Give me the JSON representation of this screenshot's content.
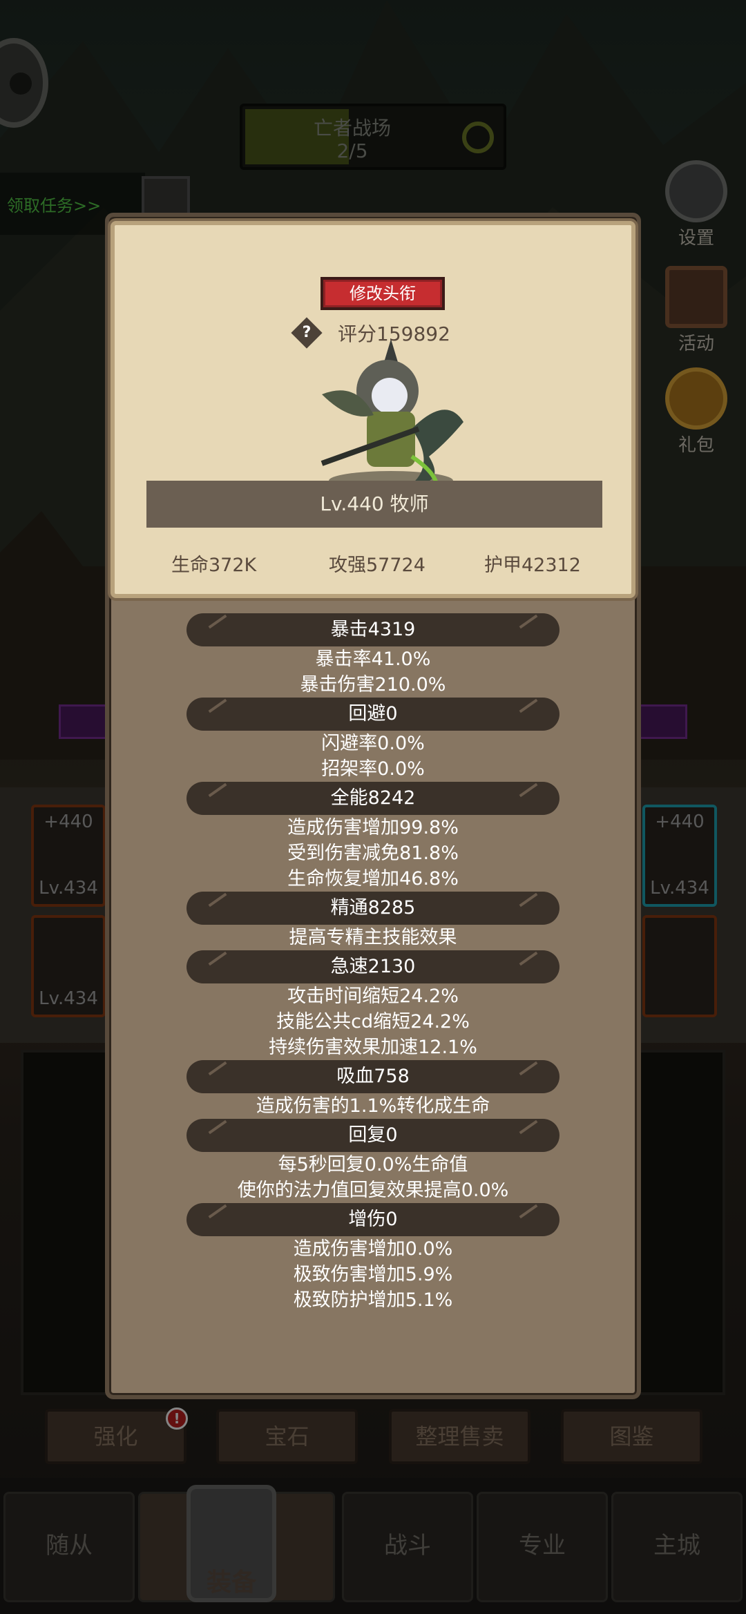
{
  "hud": {
    "arena_title": "亡者战场",
    "arena_count": "2/5",
    "task_link": "领取任务>>",
    "side_buttons": [
      {
        "label": "设置",
        "icon": "gear-icon"
      },
      {
        "label": "活动",
        "icon": "scroll-icon"
      },
      {
        "label": "礼包",
        "icon": "gift-icon"
      }
    ]
  },
  "background_equipment": [
    {
      "plus": "+440",
      "level": "Lv.434"
    },
    {
      "plus": "",
      "level": "Lv.434"
    },
    {
      "plus": "+440",
      "level": "Lv.434"
    }
  ],
  "modal": {
    "rename_button": "修改头衔",
    "score": "评分159892",
    "level_class": "Lv.440 牧师",
    "stats": {
      "hp": "生命372K",
      "attack": "攻强57724",
      "armor": "护甲42312"
    },
    "attributes": [
      {
        "header": "暴击4319",
        "lines": [
          "暴击率41.0%",
          "暴击伤害210.0%"
        ]
      },
      {
        "header": "回避0",
        "lines": [
          "闪避率0.0%",
          "招架率0.0%"
        ]
      },
      {
        "header": "全能8242",
        "lines": [
          "造成伤害增加99.8%",
          "受到伤害减免81.8%",
          "生命恢复增加46.8%"
        ]
      },
      {
        "header": "精通8285",
        "lines": [
          "提高专精主技能效果"
        ]
      },
      {
        "header": "急速2130",
        "lines": [
          "攻击时间缩短24.2%",
          "技能公共cd缩短24.2%",
          "持续伤害效果加速12.1%"
        ]
      },
      {
        "header": "吸血758",
        "lines": [
          "造成伤害的1.1%转化成生命"
        ]
      },
      {
        "header": "回复0",
        "lines": [
          "每5秒回复0.0%生命值",
          "使你的法力值回复效果提高0.0%"
        ]
      },
      {
        "header": "增伤0",
        "lines": [
          "造成伤害增加0.0%",
          "极致伤害增加5.9%",
          "极致防护增加5.1%"
        ]
      }
    ]
  },
  "actions": {
    "enhance": "强化",
    "gem": "宝石",
    "sort_sell": "整理售卖",
    "codex": "图鉴",
    "alert": "!"
  },
  "nav": {
    "followers": "随从",
    "equipment": "装备",
    "battle": "战斗",
    "profession": "专业",
    "main_city": "主城"
  }
}
